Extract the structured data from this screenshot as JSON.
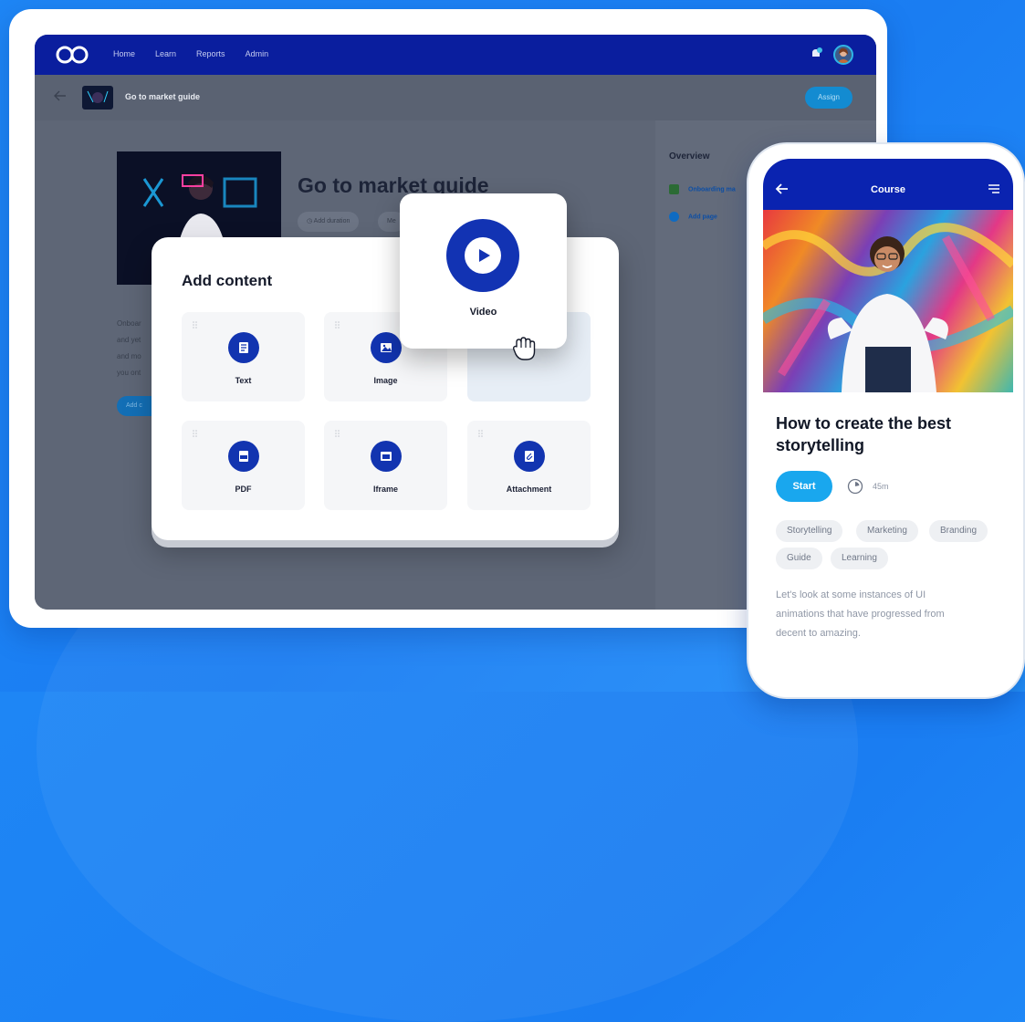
{
  "nav": {
    "items": [
      "Home",
      "Learn",
      "Reports",
      "Admin"
    ]
  },
  "subbar": {
    "title": "Go to market guide",
    "assign_label": "Assign"
  },
  "course": {
    "title": "Go to market guide",
    "chips": [
      "Add duration",
      "Me"
    ],
    "description_lines": [
      "Onboar",
      "and yet",
      "and mo",
      "you ont"
    ],
    "add_button_label": "Add c"
  },
  "overview": {
    "title": "Overview",
    "items": [
      {
        "label": "Onboarding ma",
        "icon": "thumbnail-icon"
      },
      {
        "label": "Add page",
        "icon": "plus-circle-icon"
      }
    ]
  },
  "modal": {
    "title": "Add content",
    "tiles": [
      {
        "label": "Text",
        "icon": "text-doc-icon"
      },
      {
        "label": "Image",
        "icon": "image-icon"
      },
      {
        "label": "",
        "icon": ""
      },
      {
        "label": "PDF",
        "icon": "pdf-icon"
      },
      {
        "label": "Iframe",
        "icon": "iframe-icon"
      },
      {
        "label": "Attachment",
        "icon": "paperclip-icon"
      }
    ]
  },
  "video_card": {
    "label": "Video",
    "icon": "play-icon"
  },
  "phone": {
    "header_title": "Course",
    "heading": "How to create the best storytelling",
    "start_label": "Start",
    "duration": "45m",
    "tags": [
      "Storytelling",
      "Marketing",
      "Branding",
      "Guide",
      "Learning"
    ],
    "description": "Let's look at some instances of UI animations that have progressed from decent to amazing."
  },
  "colors": {
    "background": "#1e86f5",
    "navbar": "#0a1e9e",
    "primary_icon": "#1234b0",
    "start_button": "#19a7ee"
  }
}
